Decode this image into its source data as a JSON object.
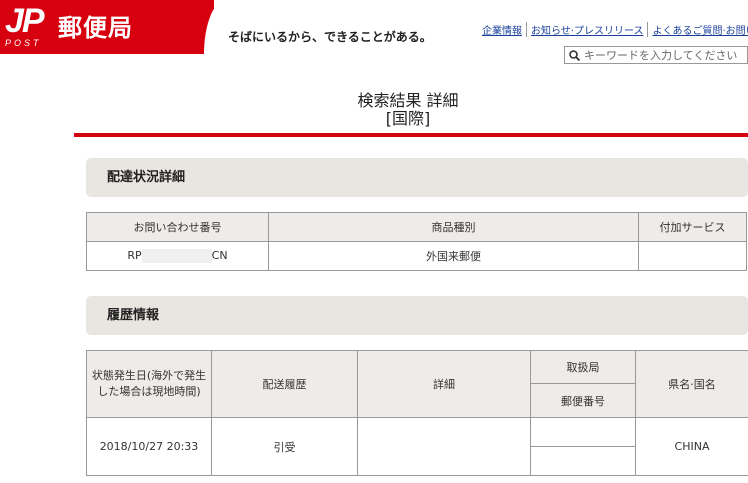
{
  "header": {
    "logo_mark": "JP",
    "logo_sub": "POST",
    "logo_text": "郵便局",
    "slogan": "そばにいるから、できることがある。",
    "nav": [
      "企業情報",
      "お知らせ·プレスリリース",
      "よくあるご質問·お問い合"
    ],
    "search_placeholder": "キーワードを入力してください"
  },
  "page": {
    "title_line1": "検索結果 詳細",
    "title_line2": "[国際]"
  },
  "delivery": {
    "heading": "配達状況詳細",
    "columns": [
      "お問い合わせ番号",
      "商品種別",
      "付加サービス"
    ],
    "tracking_prefix": "RP",
    "tracking_suffix": "CN",
    "product_type": "外国来郵便",
    "service": ""
  },
  "history": {
    "heading": "履歴情報",
    "columns": {
      "date": "状態発生日(海外で発生した場合は現地時間)",
      "status": "配送履歴",
      "detail": "詳細",
      "office": "取扱局",
      "postal": "郵便番号",
      "region": "県名·国名"
    },
    "rows": [
      {
        "date": "2018/10/27 20:33",
        "status": "引受",
        "detail": "",
        "office": "",
        "postal": "",
        "region": "CHINA"
      }
    ]
  },
  "colors": {
    "brand_red": "#d7000f",
    "section_bg": "#e9e5e1",
    "link": "#1a3f9b"
  }
}
